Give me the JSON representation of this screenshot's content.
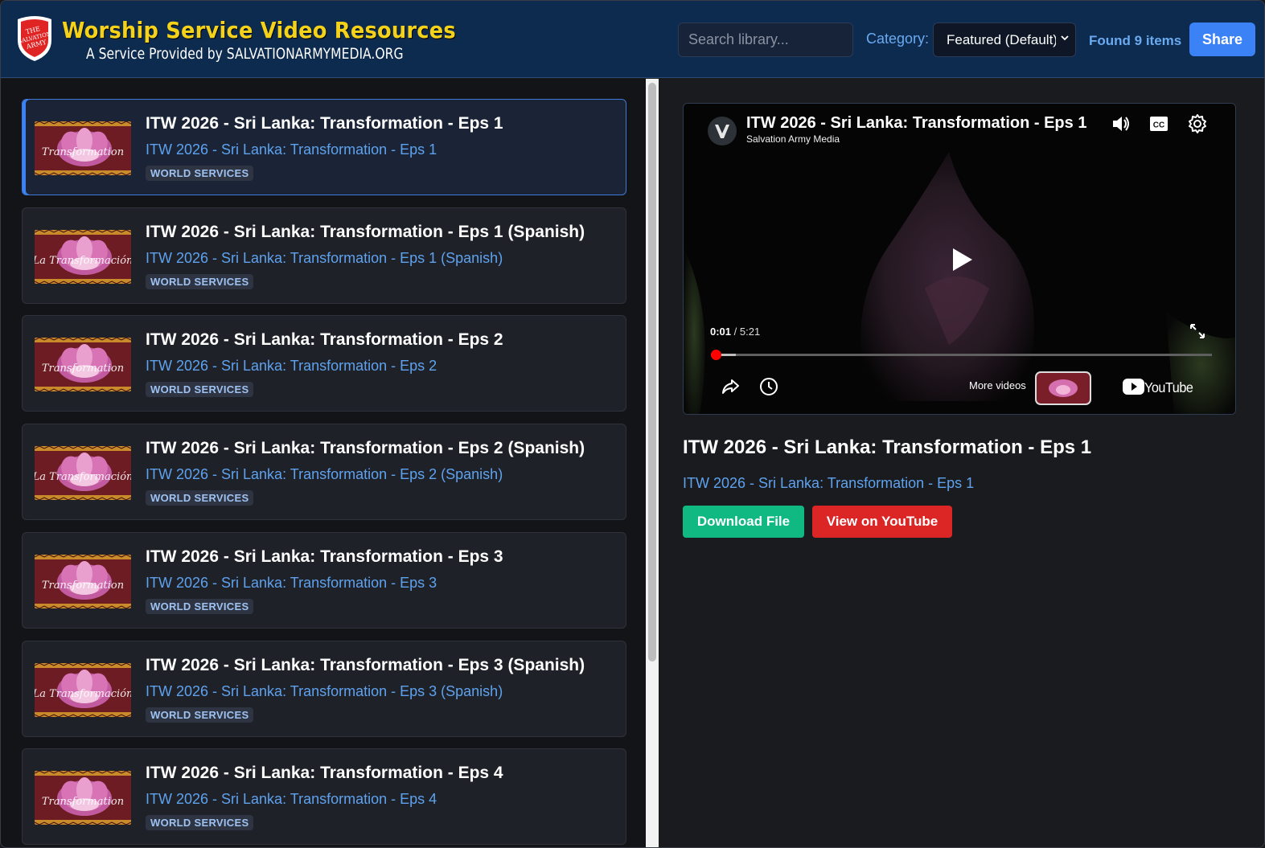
{
  "header": {
    "title": "Worship Service Video Resources",
    "subtitle": "A Service Provided by SALVATIONARMYMEDIA.ORG",
    "logo_text": [
      "THE",
      "SALVATION",
      "ARMY"
    ],
    "search_placeholder": "Search library...",
    "category_label": "Category:",
    "category_selected": "Featured (Default)",
    "found_text": "Found 9 items",
    "share_label": "Share"
  },
  "videos": [
    {
      "title": "ITW 2026 - Sri Lanka: Transformation - Eps 1",
      "subtitle": "ITW 2026 - Sri Lanka: Transformation - Eps 1",
      "badge": "WORLD SERVICES",
      "thumb_text": "Transformation"
    },
    {
      "title": "ITW 2026 - Sri Lanka: Transformation - Eps 1 (Spanish)",
      "subtitle": "ITW 2026 - Sri Lanka: Transformation - Eps 1 (Spanish)",
      "badge": "WORLD SERVICES",
      "thumb_text": "La Transformación"
    },
    {
      "title": "ITW 2026 - Sri Lanka: Transformation - Eps 2",
      "subtitle": "ITW 2026 - Sri Lanka: Transformation - Eps 2",
      "badge": "WORLD SERVICES",
      "thumb_text": "Transformation"
    },
    {
      "title": "ITW 2026 - Sri Lanka: Transformation - Eps 2 (Spanish)",
      "subtitle": "ITW 2026 - Sri Lanka: Transformation - Eps 2 (Spanish)",
      "badge": "WORLD SERVICES",
      "thumb_text": "La Transformación"
    },
    {
      "title": "ITW 2026 - Sri Lanka: Transformation - Eps 3",
      "subtitle": "ITW 2026 - Sri Lanka: Transformation - Eps 3",
      "badge": "WORLD SERVICES",
      "thumb_text": "Transformation"
    },
    {
      "title": "ITW 2026 - Sri Lanka: Transformation - Eps 3 (Spanish)",
      "subtitle": "ITW 2026 - Sri Lanka: Transformation - Eps 3 (Spanish)",
      "badge": "WORLD SERVICES",
      "thumb_text": "La Transformación"
    },
    {
      "title": "ITW 2026 - Sri Lanka: Transformation - Eps 4",
      "subtitle": "ITW 2026 - Sri Lanka: Transformation - Eps 4",
      "badge": "WORLD SERVICES",
      "thumb_text": "Transformation"
    }
  ],
  "player": {
    "title": "ITW 2026 - Sri Lanka: Transformation - Eps 1",
    "channel": "Salvation Army Media",
    "current_time": "0:01",
    "duration": "/ 5:21",
    "progress_fraction": 0.05,
    "more_videos_label": "More videos",
    "youtube_label": "YouTube",
    "cc_label": "CC"
  },
  "selected": {
    "title": "ITW 2026 - Sri Lanka: Transformation - Eps 1",
    "subtitle": "ITW 2026 - Sri Lanka: Transformation - Eps 1",
    "download_label": "Download File",
    "youtube_label": "View on YouTube"
  },
  "colors": {
    "header_bg": "#0d2a4f",
    "brand_yellow": "#f5d21a",
    "accent_blue": "#3b82f6",
    "link_blue": "#5ea2ee",
    "download_green": "#10b981",
    "youtube_red": "#dc2626"
  }
}
